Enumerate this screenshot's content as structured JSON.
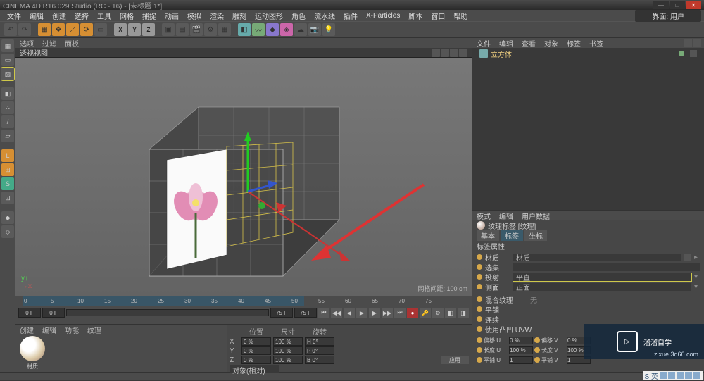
{
  "title": "CINEMA 4D R16.029 Studio (RC - 16) - [未标题 1*]",
  "menu": [
    "文件",
    "编辑",
    "创建",
    "选择",
    "工具",
    "网格",
    "捕捉",
    "动画",
    "模拟",
    "渲染",
    "雕刻",
    "运动图形",
    "角色",
    "流水线",
    "插件",
    "X-Particles",
    "脚本",
    "窗口",
    "帮助"
  ],
  "layout_label": "界面: 用户",
  "vptabs": [
    "选项",
    "过滤",
    "面板"
  ],
  "vplabel": "透视视图",
  "hud": "网格间距: 100 cm",
  "timeline": {
    "start": "0 F",
    "cur": "0 F",
    "end": "75 F",
    "end2": "75 F",
    "ticks": [
      "0",
      "5",
      "10",
      "15",
      "20",
      "25",
      "30",
      "35",
      "40",
      "45",
      "50",
      "55",
      "60",
      "65",
      "70",
      "75"
    ]
  },
  "mat": {
    "tabs": [
      "创建",
      "编辑",
      "功能",
      "纹理"
    ],
    "name": "材质"
  },
  "coord": {
    "header": [
      "位置",
      "尺寸",
      "旋转"
    ],
    "x": {
      "p": "0 %",
      "s": "100 %",
      "r": "H 0°"
    },
    "y": {
      "p": "0 %",
      "s": "100 %",
      "r": "P 0°"
    },
    "z": {
      "p": "0 %",
      "s": "100 %",
      "r": "B 0°"
    },
    "mode": "对象(相对)",
    "apply": "应用"
  },
  "right_tabs_top": [
    "文件",
    "编辑",
    "查看",
    "对象",
    "标签",
    "书签"
  ],
  "obj": {
    "name": "立方体"
  },
  "attr": {
    "tabs": [
      "模式",
      "编辑",
      "用户数据"
    ],
    "title": "纹理标签 [纹理]",
    "subtabs": [
      "基本",
      "标签",
      "坐标"
    ],
    "section": "标签属性",
    "rows": [
      {
        "lbl": "材质",
        "val": "材质"
      },
      {
        "lbl": "选集",
        "val": ""
      },
      {
        "lbl": "投射",
        "val": "平直",
        "hl": true
      },
      {
        "lbl": "侧面",
        "val": "正面"
      }
    ],
    "extras": [
      "混合纹理",
      "平铺",
      "连续",
      "使用凸凹 UVW"
    ],
    "uvw": [
      {
        "l1": "偏移 U",
        "v1": "0 %",
        "l2": "偏移 V",
        "v2": "0 %"
      },
      {
        "l1": "长度 U",
        "v1": "100 %",
        "l2": "长度 V",
        "v2": "100 %"
      },
      {
        "l1": "平铺 U",
        "v1": "1",
        "l2": "平铺 V",
        "v2": "1"
      }
    ]
  },
  "watermark": {
    "brand": "溜溜自学",
    "url": "zixue.3d66.com"
  }
}
